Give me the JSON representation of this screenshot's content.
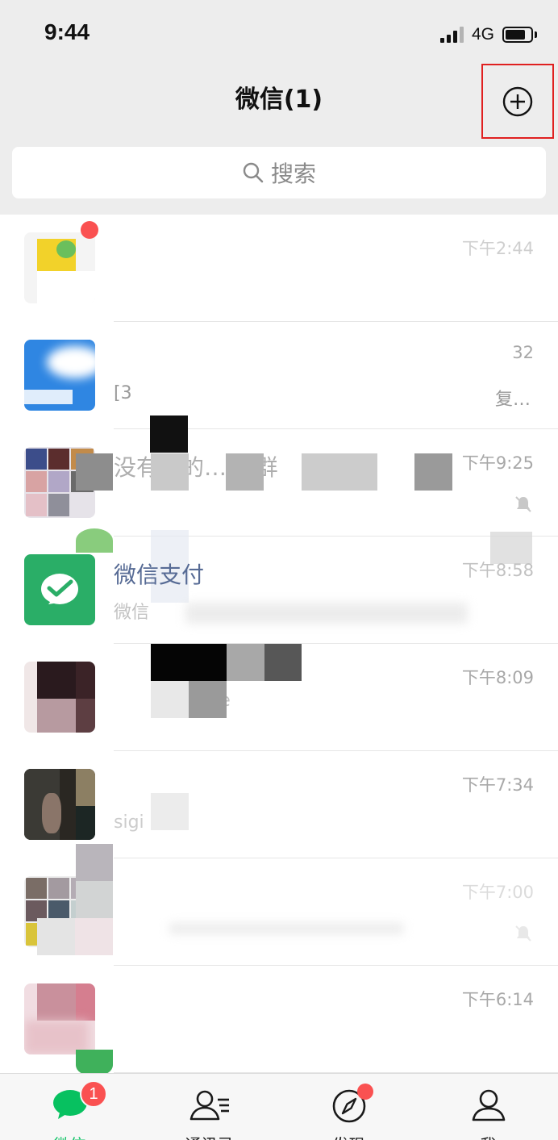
{
  "status_bar": {
    "time": "9:44",
    "network": "4G",
    "signal_icon": "signal-bars-icon",
    "battery_icon": "battery-icon"
  },
  "header": {
    "title": "微信(1)",
    "add_icon": "plus-circle-icon",
    "highlight_color": "#e02020"
  },
  "search": {
    "placeholder": "搜索",
    "icon": "search-icon"
  },
  "chats": [
    {
      "name": "",
      "preview": "",
      "time": "下午2:44",
      "tail": "",
      "muted": false,
      "unread_dot": true
    },
    {
      "name": "",
      "preview": "[3",
      "time": "32",
      "tail": "复…",
      "muted": false,
      "unread_dot": false
    },
    {
      "name": "没有我的…34群",
      "preview": "",
      "time": "下午9:25",
      "tail": "",
      "muted": true,
      "unread_dot": false
    },
    {
      "name": "微信支付",
      "preview": "微信",
      "time": "下午8:58",
      "tail": "",
      "muted": false,
      "unread_dot": false
    },
    {
      "name": "",
      "preview": "nVe",
      "time": "下午8:09",
      "tail": "",
      "muted": false,
      "unread_dot": false
    },
    {
      "name": "",
      "preview": "sigi",
      "time": "下午7:34",
      "tail": "",
      "muted": false,
      "unread_dot": false
    },
    {
      "name": "",
      "preview": "",
      "time": "下午7:00",
      "tail": "",
      "muted": true,
      "unread_dot": false
    },
    {
      "name": "",
      "preview": "",
      "time": "下午6:14",
      "tail": "",
      "muted": false,
      "unread_dot": false
    }
  ],
  "tab_bar": {
    "tabs": [
      {
        "label": "微信",
        "icon": "chat-bubble-icon",
        "badge": "1",
        "active": true
      },
      {
        "label": "通讯录",
        "icon": "contacts-icon",
        "badge": "",
        "active": false
      },
      {
        "label": "发现",
        "icon": "compass-icon",
        "badge": "",
        "dot": true,
        "active": false
      },
      {
        "label": "我",
        "icon": "person-icon",
        "badge": "",
        "active": false
      }
    ]
  },
  "colors": {
    "brand_green": "#07c160",
    "badge_red": "#fa5151",
    "header_bg": "#ededed"
  }
}
